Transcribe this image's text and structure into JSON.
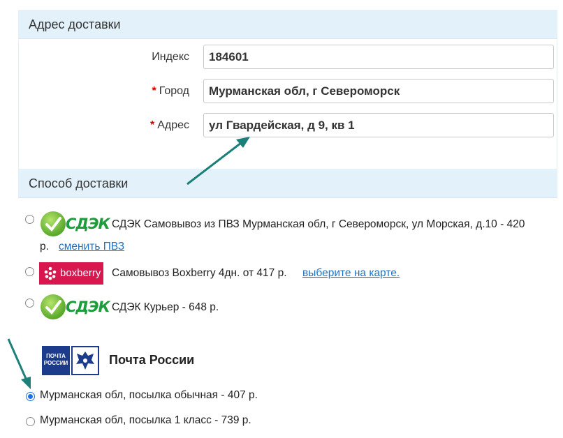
{
  "address_section": {
    "title": "Адрес доставки",
    "fields": [
      {
        "label": "Индекс",
        "required": false,
        "value": "184601"
      },
      {
        "label": "Город",
        "required": true,
        "value": "Мурманская обл, г Североморск"
      },
      {
        "label": "Адрес",
        "required": true,
        "value": "ул Гвардейская, д 9, кв 1"
      }
    ],
    "required_mark": "*"
  },
  "delivery_section": {
    "title": "Способ доставки",
    "options": [
      {
        "carrier_logo": "cdek-logo",
        "logo_text": "СДЭК",
        "text_line1": "СДЭК Самовывоз из ПВЗ Мурманская обл, г Североморск, ул Морская, д.10 - 420",
        "text_line2": "р.",
        "link": "сменить ПВЗ",
        "selected": false
      },
      {
        "carrier_logo": "boxberry-logo",
        "logo_text": "boxberry",
        "text_line1": "Самовывоз Boxberry 4дн. от 417 р.",
        "link": "выберите на карте.",
        "selected": false
      },
      {
        "carrier_logo": "cdek-logo",
        "logo_text": "СДЭК",
        "text_line1": "СДЭК Курьер - 648 р.",
        "selected": false
      }
    ],
    "post": {
      "logo_text": "ПОЧТА РОССИИ",
      "title": "Почта России",
      "options": [
        {
          "text": "Мурманская обл, посылка обычная - 407 р.",
          "selected": true
        },
        {
          "text": "Мурманская обл, посылка 1 класс - 739 р.",
          "selected": false
        }
      ]
    }
  },
  "colors": {
    "header_bg": "#e3f1fb",
    "link": "#1a73c8",
    "required": "#d40000",
    "annotation_arrow": "#1b7f7a",
    "radio_selected": "#1a73e8"
  }
}
